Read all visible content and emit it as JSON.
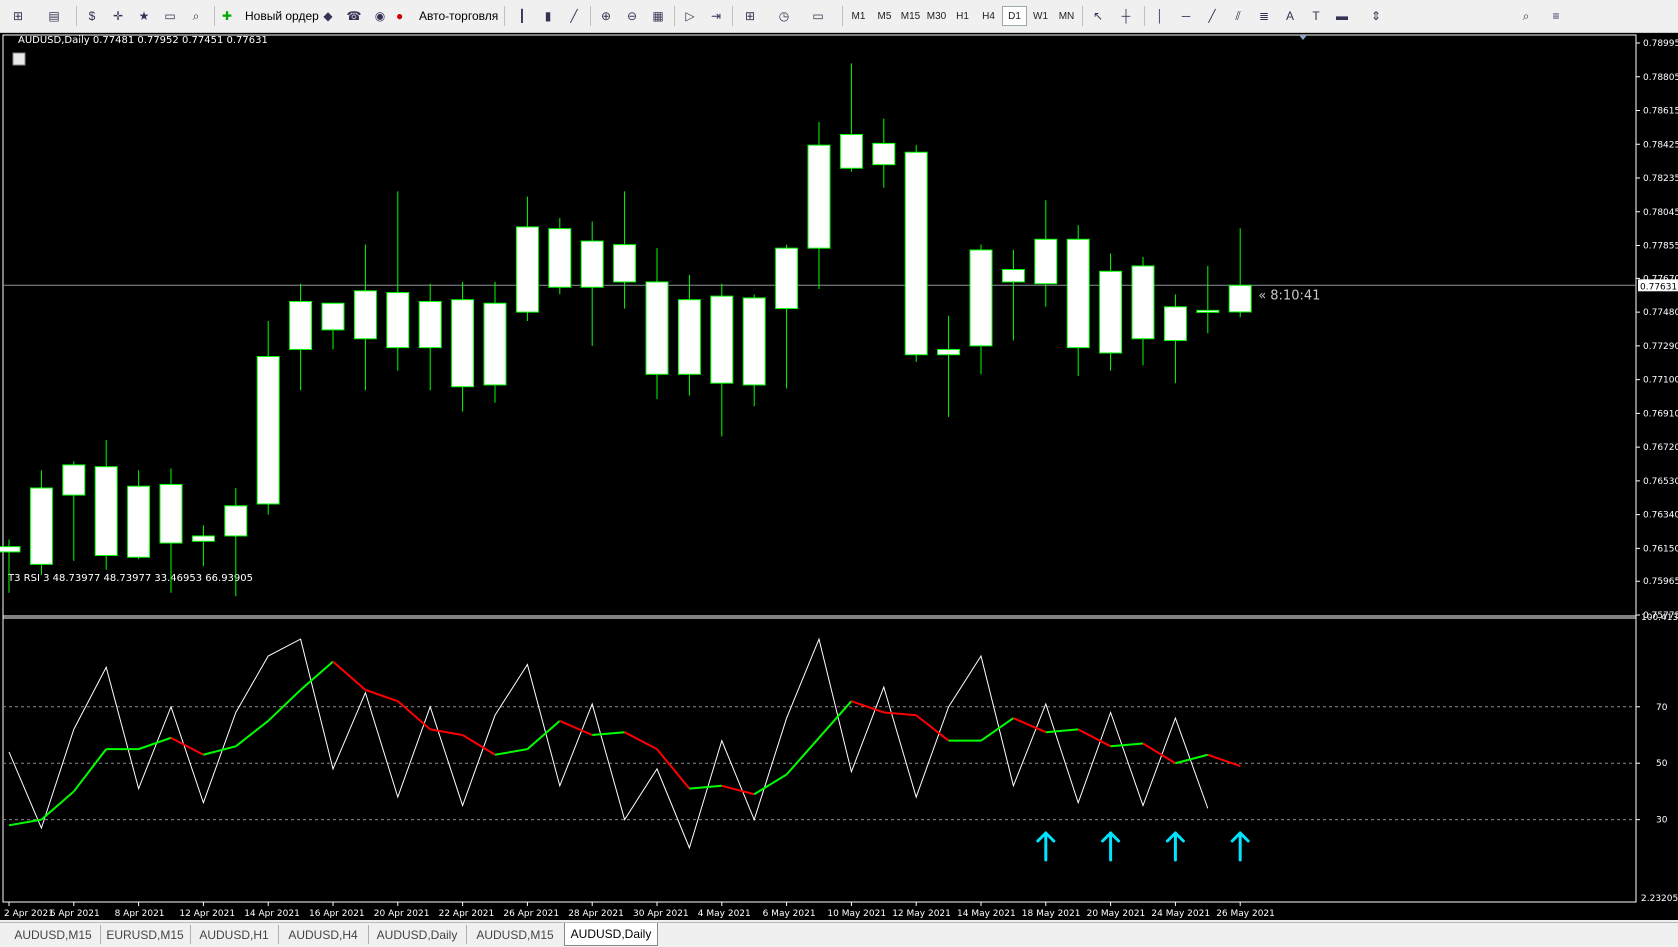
{
  "toolbar": {
    "new_order_label": "Новый ордер",
    "autotrade_label": "Авто-торговля",
    "timeframes": [
      "M1",
      "M5",
      "M15",
      "M30",
      "H1",
      "H4",
      "D1",
      "W1",
      "MN"
    ],
    "active_timeframe": "D1"
  },
  "chart": {
    "header": "AUDUSD,Daily  0.77481 0.77952 0.77451 0.77631",
    "timer": "« 8:10:41",
    "current_price": "0.77631",
    "price_ticks": [
      "0.78995",
      "0.78805",
      "0.78615",
      "0.78425",
      "0.78235",
      "0.78045",
      "0.77855",
      "0.77670",
      "0.77480",
      "0.77290",
      "0.77100",
      "0.76910",
      "0.76720",
      "0.76530",
      "0.76340",
      "0.76150",
      "0.75965",
      "0.75775"
    ],
    "date_labels": [
      "2 Apr 2021",
      "6 Apr 2021",
      "8 Apr 2021",
      "12 Apr 2021",
      "14 Apr 2021",
      "16 Apr 2021",
      "20 Apr 2021",
      "22 Apr 2021",
      "26 Apr 2021",
      "28 Apr 2021",
      "30 Apr 2021",
      "4 May 2021",
      "6 May 2021",
      "10 May 2021",
      "12 May 2021",
      "14 May 2021",
      "18 May 2021",
      "20 May 2021",
      "24 May 2021",
      "26 May 2021"
    ],
    "bull_color": "#00ff00",
    "candle_body_color": "#ffffff"
  },
  "indicator": {
    "header": "T3 RSI 3 48.73977 48.73977 33.46953 66.93905",
    "max_label": "100.41332",
    "min_label": "2.23205",
    "levels": [
      "70",
      "50",
      "30"
    ],
    "rsi_color": "#ffffff",
    "signal_up_color": "#00ff00",
    "signal_down_color": "#ff0000",
    "arrow_color": "#00e5ff"
  },
  "tabs": [
    "AUDUSD,M15",
    "EURUSD,M15",
    "AUDUSD,H1",
    "AUDUSD,H4",
    "AUDUSD,Daily",
    "AUDUSD,M15",
    "AUDUSD,Daily"
  ],
  "active_tab": 6,
  "chart_data": {
    "type": "candlestick",
    "ohlc": [
      {
        "o": 0.7616,
        "h": 0.762,
        "l": 0.759,
        "c": 0.7613
      },
      {
        "o": 0.7606,
        "h": 0.7659,
        "l": 0.76,
        "c": 0.7649
      },
      {
        "o": 0.7645,
        "h": 0.7664,
        "l": 0.7608,
        "c": 0.7662
      },
      {
        "o": 0.7661,
        "h": 0.7676,
        "l": 0.7603,
        "c": 0.7611
      },
      {
        "o": 0.765,
        "h": 0.7659,
        "l": 0.7609,
        "c": 0.761
      },
      {
        "o": 0.7651,
        "h": 0.766,
        "l": 0.759,
        "c": 0.7618
      },
      {
        "o": 0.7619,
        "h": 0.7628,
        "l": 0.7605,
        "c": 0.7622
      },
      {
        "o": 0.7622,
        "h": 0.7649,
        "l": 0.7588,
        "c": 0.7639
      },
      {
        "o": 0.764,
        "h": 0.7743,
        "l": 0.7634,
        "c": 0.7723
      },
      {
        "o": 0.7727,
        "h": 0.7764,
        "l": 0.7704,
        "c": 0.7754
      },
      {
        "o": 0.7753,
        "h": 0.7752,
        "l": 0.7727,
        "c": 0.7738
      },
      {
        "o": 0.7733,
        "h": 0.7786,
        "l": 0.7704,
        "c": 0.776
      },
      {
        "o": 0.7759,
        "h": 0.7816,
        "l": 0.7715,
        "c": 0.7728
      },
      {
        "o": 0.7728,
        "h": 0.7764,
        "l": 0.7704,
        "c": 0.7754
      },
      {
        "o": 0.7755,
        "h": 0.7765,
        "l": 0.7692,
        "c": 0.7706
      },
      {
        "o": 0.7707,
        "h": 0.7765,
        "l": 0.7697,
        "c": 0.7753
      },
      {
        "o": 0.7748,
        "h": 0.7813,
        "l": 0.7743,
        "c": 0.7796
      },
      {
        "o": 0.7795,
        "h": 0.7801,
        "l": 0.7758,
        "c": 0.7762
      },
      {
        "o": 0.7762,
        "h": 0.7799,
        "l": 0.7729,
        "c": 0.7788
      },
      {
        "o": 0.7786,
        "h": 0.7816,
        "l": 0.775,
        "c": 0.7765
      },
      {
        "o": 0.7765,
        "h": 0.7784,
        "l": 0.7699,
        "c": 0.7713
      },
      {
        "o": 0.7713,
        "h": 0.7769,
        "l": 0.7701,
        "c": 0.7755
      },
      {
        "o": 0.7757,
        "h": 0.7764,
        "l": 0.7678,
        "c": 0.7708
      },
      {
        "o": 0.7756,
        "h": 0.7758,
        "l": 0.7695,
        "c": 0.7707
      },
      {
        "o": 0.775,
        "h": 0.7786,
        "l": 0.7705,
        "c": 0.7784
      },
      {
        "o": 0.7784,
        "h": 0.7855,
        "l": 0.7761,
        "c": 0.7842
      },
      {
        "o": 0.7848,
        "h": 0.7888,
        "l": 0.7827,
        "c": 0.7829
      },
      {
        "o": 0.7843,
        "h": 0.7857,
        "l": 0.7818,
        "c": 0.7831
      },
      {
        "o": 0.7838,
        "h": 0.7842,
        "l": 0.772,
        "c": 0.7724
      },
      {
        "o": 0.7724,
        "h": 0.7746,
        "l": 0.7689,
        "c": 0.7727
      },
      {
        "o": 0.7729,
        "h": 0.7786,
        "l": 0.7713,
        "c": 0.7783
      },
      {
        "o": 0.7772,
        "h": 0.7783,
        "l": 0.7732,
        "c": 0.7765
      },
      {
        "o": 0.7764,
        "h": 0.7811,
        "l": 0.7751,
        "c": 0.7789
      },
      {
        "o": 0.7789,
        "h": 0.7797,
        "l": 0.7712,
        "c": 0.7728
      },
      {
        "o": 0.7771,
        "h": 0.7781,
        "l": 0.7715,
        "c": 0.7725
      },
      {
        "o": 0.7774,
        "h": 0.7779,
        "l": 0.7718,
        "c": 0.7733
      },
      {
        "o": 0.7732,
        "h": 0.7758,
        "l": 0.7708,
        "c": 0.7751
      },
      {
        "o": 0.7748,
        "h": 0.7774,
        "l": 0.7736,
        "c": 0.7749
      },
      {
        "o": 0.77481,
        "h": 0.77952,
        "l": 0.77451,
        "c": 0.77631
      }
    ],
    "rsi": [
      54,
      27,
      62,
      84,
      41,
      70,
      36,
      68,
      88,
      94,
      48,
      75,
      38,
      70,
      35,
      67,
      85,
      42,
      71,
      30,
      48,
      20,
      58,
      30,
      66,
      94,
      47,
      77,
      38,
      70,
      88,
      42,
      71,
      36,
      68,
      35,
      66,
      34
    ],
    "signal": [
      28,
      30,
      40,
      55,
      55,
      59,
      53,
      56,
      65,
      76,
      86,
      76,
      72,
      62,
      60,
      53,
      55,
      65,
      60,
      61,
      55,
      41,
      42,
      39,
      46,
      59,
      72,
      68,
      67,
      58,
      58,
      66,
      61,
      62,
      56,
      57,
      50,
      53,
      49
    ],
    "rsi_range": [
      2.23205,
      100.41332
    ],
    "arrows_at_bars": [
      32,
      34,
      36,
      38
    ]
  }
}
